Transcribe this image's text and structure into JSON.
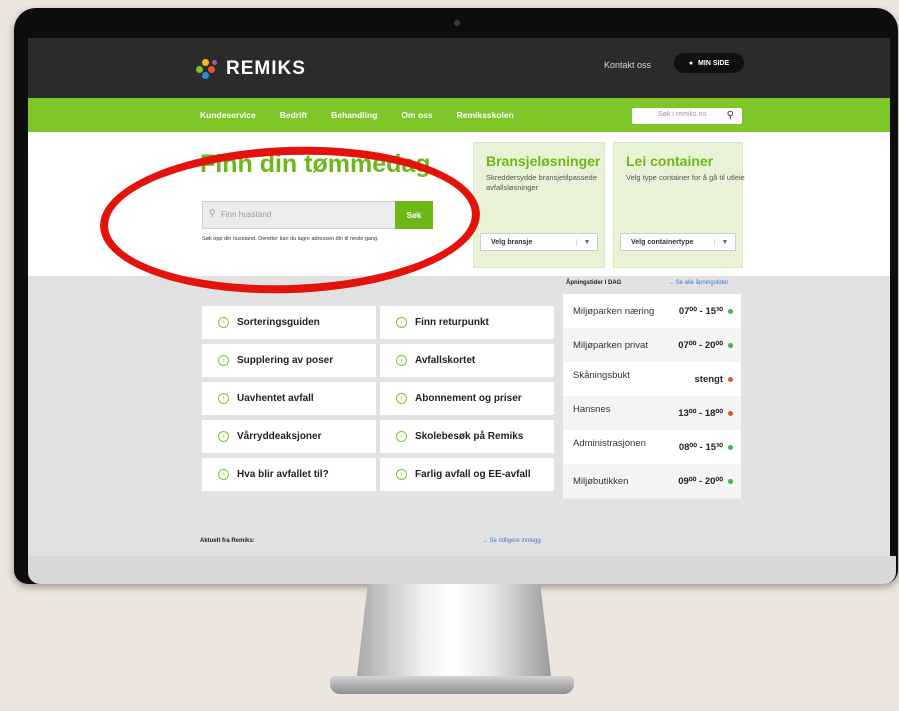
{
  "header": {
    "logo": "REMIKS",
    "contact_link": "Kontakt oss",
    "my_page_button": "MIN SIDE"
  },
  "nav": {
    "items": [
      "Kundeservice",
      "Bedrift",
      "Behandling",
      "Om oss",
      "Remiksskolen"
    ],
    "search_placeholder": "Søk i remiks.no"
  },
  "hero": {
    "title": "Finn din tømmedag",
    "input_placeholder": "Finn husstand",
    "button": "Søk",
    "note": "Søk opp din husstand. Deretter kan du lagre adressen din til neste gang."
  },
  "cards": [
    {
      "title": "Bransjeløsninger",
      "description": "Skreddersydde bransjetilpassede avfallsløsninger",
      "select": "Velg bransje"
    },
    {
      "title": "Lei container",
      "description": "Velg type container for å gå til utleie",
      "select": "Velg containertype"
    }
  ],
  "tiles": {
    "left": [
      "Sorteringsguiden",
      "Supplering av poser",
      "Uavhentet avfall",
      "Vårryddeaksjoner",
      "Hva blir avfallet til?"
    ],
    "right": [
      "Finn returpunkt",
      "Avfallskortet",
      "Abonnement og priser",
      "Skolebesøk på Remiks",
      "Farlig avfall og EE-avfall"
    ]
  },
  "hours": {
    "title": "Åpningstider I DAG",
    "link": "→ Se alle åpningstider",
    "rows": [
      {
        "name": "Miljøparken næring",
        "time": "07⁰⁰ - 15³⁰",
        "status": "open"
      },
      {
        "name": "Miljøparken privat",
        "time": "07⁰⁰ - 20⁰⁰",
        "status": "open"
      },
      {
        "name": "Skåningsbukt",
        "time": "stengt",
        "status": "closed"
      },
      {
        "name": "Hansnes",
        "time": "13⁰⁰ - 18⁰⁰",
        "status": "closed"
      },
      {
        "name": "Administrasjonen",
        "time": "08⁰⁰ - 15³⁰",
        "status": "open"
      },
      {
        "name": "Miljøbutikken",
        "time": "09⁰⁰ - 20⁰⁰",
        "status": "open"
      }
    ]
  },
  "news": {
    "title": "Aktuelt fra Remiks:",
    "link": "→ Se tidligere innlegg"
  },
  "colors": {
    "brand_green": "#7ec627",
    "open_dot": "#3fb54a",
    "closed_dot": "#e5532a",
    "annotation_red": "#e3120b"
  }
}
